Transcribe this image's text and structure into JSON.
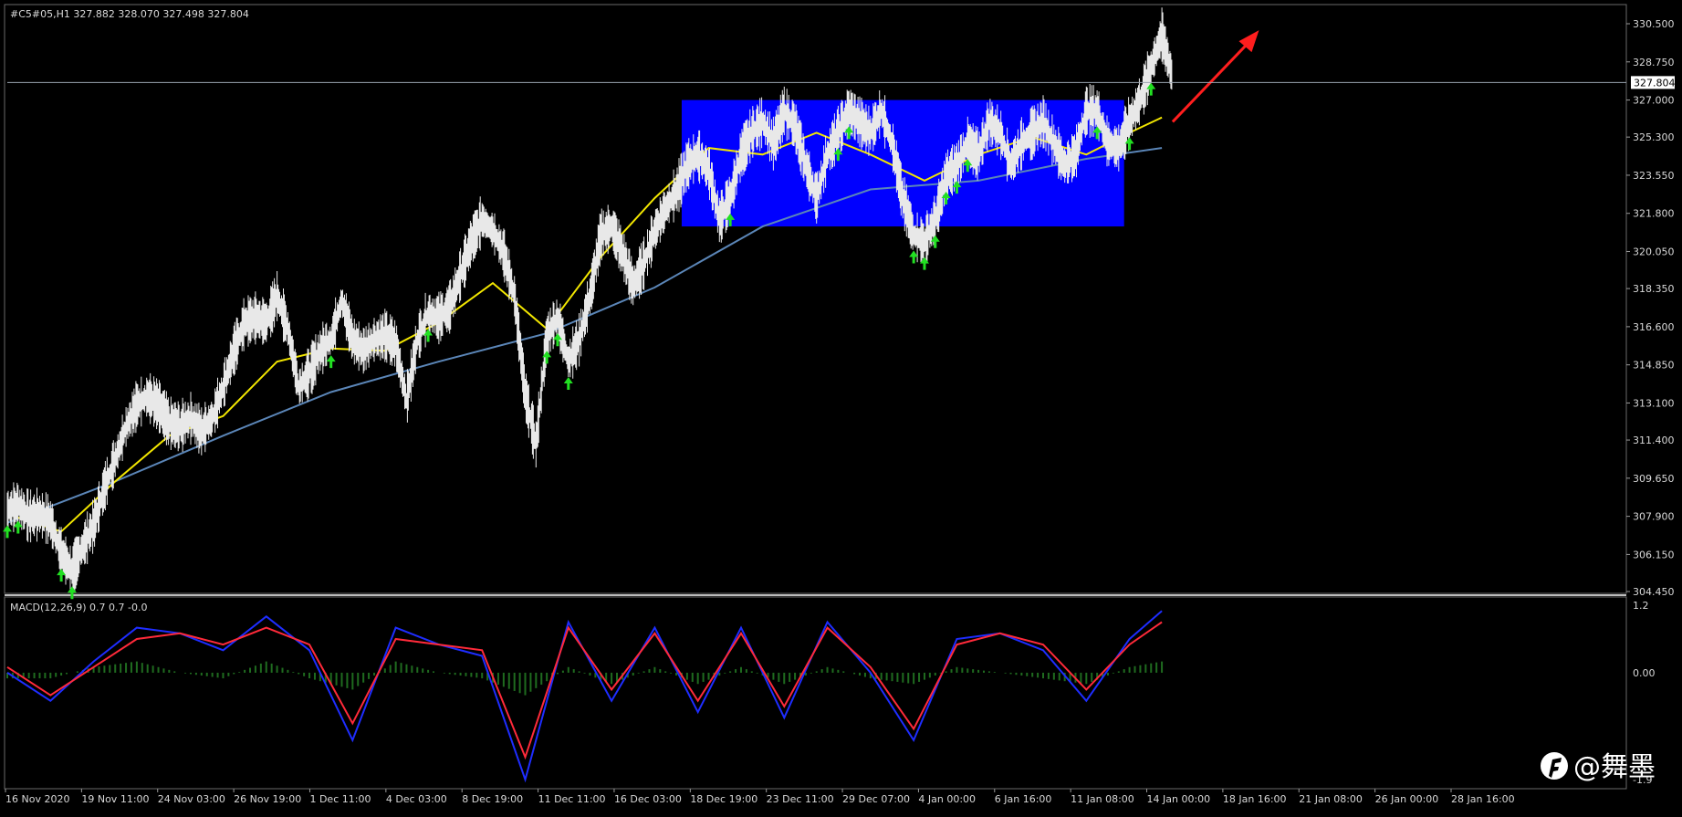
{
  "header": {
    "symbol_info": "#C5#05,H1  327.882 328.070 327.498 327.804"
  },
  "indicator": {
    "label": "MACD(12,26,9) 0.7 0.7 -0.0"
  },
  "watermark": {
    "text": "@舞墨"
  },
  "colors": {
    "background": "#000000",
    "price": "#e8e8e8",
    "ma_fast": "#f2e600",
    "ma_slow": "#5b86b8",
    "signal_arrows": "#22e022",
    "range_box": "#0000ff",
    "trend_arrow": "#ff1e1e",
    "macd_line": "#1e2dff",
    "signal_line": "#ff2a3a",
    "histogram": "#1f6b1f"
  },
  "chart_data": [
    {
      "type": "line",
      "title": "#C5#05,H1",
      "timeframe": "H1",
      "ohlc_last": {
        "open": 327.882,
        "high": 328.07,
        "low": 327.498,
        "close": 327.804
      },
      "current_price": 327.804,
      "current_price_label": "327.804",
      "ylim": [
        304.45,
        330.5
      ],
      "y_ticks": [
        304.45,
        306.15,
        307.9,
        309.65,
        311.4,
        313.1,
        314.85,
        316.6,
        318.35,
        320.05,
        321.8,
        323.55,
        325.3,
        327.0,
        328.75,
        330.5
      ],
      "y_tick_labels": [
        "304.450",
        "306.150",
        "307.900",
        "309.650",
        "311.400",
        "313.100",
        "314.850",
        "316.600",
        "318.350",
        "320.050",
        "321.800",
        "323.550",
        "325.300",
        "327.000",
        "328.750",
        "330.500"
      ],
      "x_tick_labels": [
        "16 Nov 2020",
        "19 Nov 11:00",
        "24 Nov 03:00",
        "26 Nov 19:00",
        "1 Dec 11:00",
        "4 Dec 03:00",
        "8 Dec 19:00",
        "11 Dec 11:00",
        "16 Dec 03:00",
        "18 Dec 19:00",
        "23 Dec 11:00",
        "29 Dec 07:00",
        "4 Jan 00:00",
        "6 Jan 16:00",
        "11 Jan 08:00",
        "14 Jan 00:00",
        "18 Jan 16:00",
        "21 Jan 08:00",
        "26 Jan 00:00",
        "28 Jan 16:00"
      ],
      "grid": false,
      "series": [
        {
          "key": "price",
          "x": [
            0,
            1,
            2,
            3,
            4,
            5,
            6,
            7,
            8,
            9,
            10,
            11,
            12,
            13,
            14,
            15,
            16,
            17,
            18,
            19,
            20,
            21,
            22,
            23,
            24,
            25,
            26,
            27,
            28,
            29,
            30,
            31,
            32,
            33,
            34,
            35,
            36,
            37,
            38,
            39,
            40,
            41,
            42,
            43,
            44,
            45,
            46,
            47,
            48,
            49,
            50,
            51,
            52,
            53,
            54,
            55,
            56,
            57,
            58,
            59,
            60,
            61,
            62,
            63,
            64,
            65,
            66,
            67,
            68,
            69,
            70,
            71,
            72,
            73,
            74,
            75,
            76,
            77,
            78,
            79,
            80,
            81,
            82,
            83,
            84,
            85,
            86,
            87,
            88,
            89,
            90,
            91,
            92,
            93,
            94,
            95,
            96,
            97,
            98,
            99,
            100,
            101,
            102,
            103,
            104,
            105,
            106,
            107,
            108,
            109,
            110,
            111,
            112,
            113,
            114,
            115,
            116,
            117,
            118,
            119,
            120,
            121,
            122,
            123,
            124,
            125,
            126,
            127,
            128,
            129,
            130
          ],
          "values": [
            308.2,
            308.4,
            307.9,
            308.0,
            307.7,
            306.2,
            305.4,
            306.5,
            307.5,
            309.2,
            310.5,
            312.0,
            313.0,
            313.4,
            313.0,
            312.2,
            312.0,
            312.4,
            311.8,
            312.4,
            313.8,
            315.5,
            316.8,
            317.0,
            316.8,
            318.0,
            316.5,
            313.8,
            314.5,
            315.5,
            316.0,
            317.8,
            316.0,
            315.5,
            316.0,
            316.2,
            315.8,
            313.2,
            316.0,
            317.2,
            317.0,
            317.5,
            319.0,
            320.5,
            321.5,
            321.0,
            320.0,
            318.0,
            313.5,
            311.2,
            316.2,
            317.0,
            315.0,
            316.0,
            318.0,
            320.8,
            321.2,
            320.0,
            318.5,
            319.5,
            321.0,
            322.0,
            322.8,
            324.0,
            324.5,
            323.8,
            321.5,
            322.5,
            324.5,
            325.5,
            326.0,
            325.0,
            326.5,
            325.8,
            324.0,
            322.5,
            324.5,
            325.5,
            326.5,
            326.0,
            325.5,
            326.5,
            325.0,
            322.5,
            320.8,
            320.5,
            321.5,
            323.5,
            324.0,
            325.0,
            324.5,
            326.0,
            325.5,
            324.0,
            325.0,
            325.5,
            326.0,
            325.0,
            324.0,
            324.5,
            326.5,
            326.5,
            325.0,
            324.8,
            326.0,
            327.0,
            328.5,
            330.0,
            328.0,
            327.8,
            327.8,
            327.8,
            327.8,
            327.8,
            327.8,
            327.8,
            327.8,
            327.8,
            327.8,
            327.8,
            327.8,
            327.8,
            327.8,
            327.8,
            327.8,
            327.8,
            327.8,
            327.8,
            327.8,
            327.8,
            327.8
          ]
        },
        {
          "key": "ma_fast",
          "x": [
            0,
            5,
            10,
            15,
            20,
            25,
            30,
            35,
            40,
            45,
            50,
            55,
            60,
            65,
            70,
            75,
            80,
            85,
            90,
            95,
            100,
            104,
            107
          ],
          "values": [
            308.0,
            307.2,
            309.5,
            311.6,
            312.5,
            315.0,
            315.6,
            315.5,
            316.8,
            318.6,
            316.5,
            319.8,
            322.5,
            324.8,
            324.5,
            325.5,
            324.5,
            323.3,
            324.5,
            325.3,
            324.5,
            325.5,
            326.2
          ]
        },
        {
          "key": "ma_slow",
          "x": [
            0,
            10,
            20,
            30,
            40,
            50,
            60,
            70,
            80,
            90,
            100,
            107
          ],
          "values": [
            307.6,
            309.5,
            311.6,
            313.6,
            315.0,
            316.3,
            318.4,
            321.2,
            322.9,
            323.3,
            324.3,
            324.8
          ]
        }
      ],
      "annotations": {
        "range_box": {
          "x_start": 62.5,
          "x_end": 103.5,
          "y_low": 321.2,
          "y_high": 327.0
        },
        "up_arrows_x": [
          0,
          1,
          5,
          6,
          30,
          39,
          50,
          51,
          52,
          67,
          77,
          78,
          84,
          85,
          86,
          87,
          88,
          89,
          101,
          104,
          106
        ],
        "trend_arrow": {
          "from_x": 108,
          "from_y": 326.0,
          "to_x": 116,
          "to_y": 330.2
        }
      }
    },
    {
      "type": "line",
      "title": "MACD(12,26,9)",
      "values_label": "0.7 0.7 -0.0",
      "ylim": [
        -1.9,
        1.2
      ],
      "y_tick_labels": [
        "1.2",
        "0.00",
        "-1.9"
      ],
      "series": [
        {
          "key": "macd",
          "x": [
            0,
            4,
            8,
            12,
            16,
            20,
            24,
            28,
            32,
            36,
            40,
            44,
            48,
            52,
            56,
            60,
            64,
            68,
            72,
            76,
            80,
            84,
            88,
            92,
            96,
            100,
            104,
            107
          ],
          "values": [
            0.0,
            -0.5,
            0.2,
            0.8,
            0.7,
            0.4,
            1.0,
            0.4,
            -1.2,
            0.8,
            0.5,
            0.3,
            -1.9,
            0.9,
            -0.5,
            0.8,
            -0.7,
            0.8,
            -0.8,
            0.9,
            0.0,
            -1.2,
            0.6,
            0.7,
            0.4,
            -0.5,
            0.6,
            1.1
          ]
        },
        {
          "key": "signal",
          "x": [
            0,
            4,
            8,
            12,
            16,
            20,
            24,
            28,
            32,
            36,
            40,
            44,
            48,
            52,
            56,
            60,
            64,
            68,
            72,
            76,
            80,
            84,
            88,
            92,
            96,
            100,
            104,
            107
          ],
          "values": [
            0.1,
            -0.4,
            0.1,
            0.6,
            0.7,
            0.5,
            0.8,
            0.5,
            -0.9,
            0.6,
            0.5,
            0.4,
            -1.5,
            0.8,
            -0.3,
            0.7,
            -0.5,
            0.7,
            -0.6,
            0.8,
            0.1,
            -1.0,
            0.5,
            0.7,
            0.5,
            -0.3,
            0.5,
            0.9
          ]
        },
        {
          "key": "histogram",
          "x": [
            0,
            4,
            8,
            12,
            16,
            20,
            24,
            28,
            32,
            36,
            40,
            44,
            48,
            52,
            56,
            60,
            64,
            68,
            72,
            76,
            80,
            84,
            88,
            92,
            96,
            100,
            104,
            107
          ],
          "values": [
            -0.1,
            -0.1,
            0.1,
            0.2,
            0.0,
            -0.1,
            0.2,
            -0.1,
            -0.3,
            0.2,
            0.0,
            -0.1,
            -0.4,
            0.1,
            -0.2,
            0.1,
            -0.2,
            0.1,
            -0.2,
            0.1,
            -0.1,
            -0.2,
            0.1,
            0.0,
            -0.1,
            -0.2,
            0.1,
            0.2
          ]
        }
      ]
    }
  ]
}
